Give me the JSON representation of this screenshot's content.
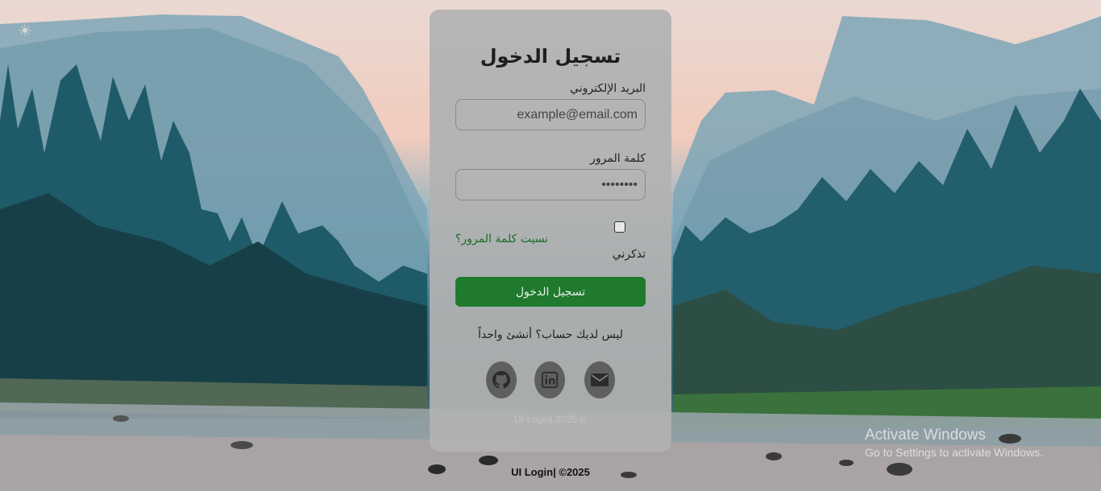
{
  "theme_toggle": {
    "icon": "sun-icon",
    "glyph": "☀"
  },
  "login": {
    "title": "تسجيل الدخول",
    "email_label": "البريد الإلكتروني",
    "email_placeholder": "example@email.com",
    "password_label": "كلمة المرور",
    "password_value": "••••••••",
    "remember_label": "تذكرني",
    "remember_checked": false,
    "forgot_link": "نسيت كلمة المرور؟",
    "submit_label": "تسجيل الدخول",
    "signup_text": "ليس لديك حساب؟ أنشئ واحداً",
    "card_footer": "UI Login| 2025 ©"
  },
  "socials": [
    {
      "icon": "github-icon"
    },
    {
      "icon": "linkedin-icon"
    },
    {
      "icon": "email-icon"
    }
  ],
  "footer": {
    "text": "UI Login| ©2025"
  },
  "watermark": {
    "line1": "Activate Windows",
    "line2": "Go to Settings to activate Windows."
  },
  "colors": {
    "accent_green": "#1f7a2e",
    "link_green": "#1e6b26",
    "card_bg": "#b2b2b2",
    "social_bg": "#5f5f5f"
  }
}
